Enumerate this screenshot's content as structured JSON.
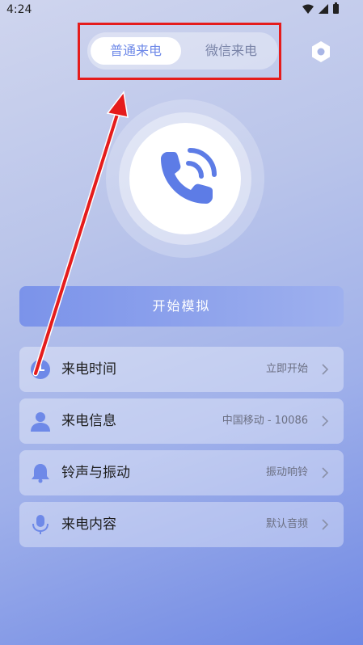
{
  "status_bar": {
    "time": "4:24"
  },
  "tabs": [
    {
      "label": "普通来电",
      "selected": true
    },
    {
      "label": "微信来电",
      "selected": false
    }
  ],
  "start_button": {
    "label": "开始模拟"
  },
  "settings": [
    {
      "label": "来电时间",
      "value": "立即开始",
      "icon": "clock-icon"
    },
    {
      "label": "来电信息",
      "value": "中国移动 - 10086",
      "icon": "person-icon"
    },
    {
      "label": "铃声与振动",
      "value": "振动响铃",
      "icon": "bell-icon"
    },
    {
      "label": "来电内容",
      "value": "默认音频",
      "icon": "microphone-icon"
    }
  ],
  "colors": {
    "accent": "#6e89e8",
    "annotation": "#e51c1c"
  }
}
